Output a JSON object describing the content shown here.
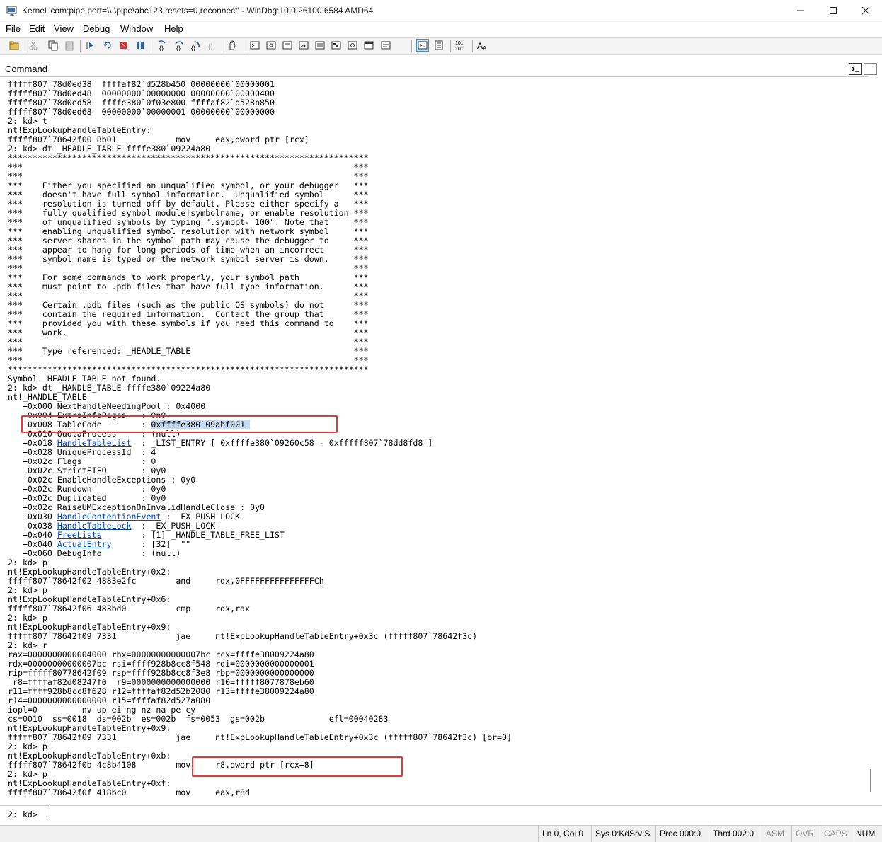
{
  "window": {
    "title": "Kernel 'com:pipe,port=\\\\.\\pipe\\abc123,resets=0,reconnect' - WinDbg:10.0.26100.6584 AMD64"
  },
  "menu": [
    {
      "accel": "F",
      "rest": "ile"
    },
    {
      "accel": "E",
      "rest": "dit"
    },
    {
      "accel": "V",
      "rest": "iew"
    },
    {
      "accel": "D",
      "rest": "ebug"
    },
    {
      "accel": "W",
      "rest": "indow"
    },
    {
      "accel": "H",
      "rest": "elp"
    }
  ],
  "toolbar_icons": [
    "open-icon",
    "cut-icon",
    "copy-icon",
    "paste-icon",
    "go-icon",
    "restart-icon",
    "stop-debugging-icon",
    "break-icon",
    "step-into-icon",
    "step-over-icon",
    "step-out-icon",
    "run-to-cursor-icon",
    "source-mode-icon",
    "command-icon",
    "watch-icon",
    "locals-icon",
    "registers-icon",
    "memory-icon",
    "call-stack-icon",
    "disassembly-icon",
    "scratch-pad-icon",
    "processes-icon",
    "source-mode-on-icon",
    "binary-icon",
    "font-icon",
    "options-icon"
  ],
  "panel": {
    "title": "Command"
  },
  "output_lines": [
    "fffff807`78d0ed38  ffffaf82`d528b450 00000000`00000001",
    "fffff807`78d0ed48  00000000`00000000 00000000`00000400",
    "fffff807`78d0ed58  ffffe380`0f03e800 ffffaf82`d528b850",
    "fffff807`78d0ed68  00000000`00000001 00000000`00000000",
    "2: kd> t",
    "nt!ExpLookupHandleTableEntry:",
    "fffff807`78642f00 8b01            mov     eax,dword ptr [rcx]",
    "2: kd> dt _HEADLE_TABLE ffffe380`09224a80",
    "*************************************************************************",
    "***                                                                   ***",
    "***                                                                   ***",
    "***    Either you specified an unqualified symbol, or your debugger   ***",
    "***    doesn't have full symbol information.  Unqualified symbol      ***",
    "***    resolution is turned off by default. Please either specify a   ***",
    "***    fully qualified symbol module!symbolname, or enable resolution ***",
    "***    of unqualified symbols by typing \".symopt- 100\". Note that     ***",
    "***    enabling unqualified symbol resolution with network symbol     ***",
    "***    server shares in the symbol path may cause the debugger to     ***",
    "***    appear to hang for long periods of time when an incorrect      ***",
    "***    symbol name is typed or the network symbol server is down.     ***",
    "***                                                                   ***",
    "***    For some commands to work properly, your symbol path           ***",
    "***    must point to .pdb files that have full type information.      ***",
    "***                                                                   ***",
    "***    Certain .pdb files (such as the public OS symbols) do not      ***",
    "***    contain the required information.  Contact the group that      ***",
    "***    provided you with these symbols if you need this command to    ***",
    "***    work.                                                          ***",
    "***                                                                   ***",
    "***    Type referenced: _HEADLE_TABLE                                 ***",
    "***                                                                   ***",
    "*************************************************************************",
    "Symbol _HEADLE_TABLE not found.",
    "2: kd> dt _HANDLE_TABLE ffffe380`09224a80",
    "nt!_HANDLE_TABLE",
    "   +0x000 NextHandleNeedingPool : 0x4000",
    "   +0x004 ExtraInfoPages   : 0n0",
    {
      "pre": "   +0x008 TableCode        : ",
      "hl": "0xffffe380`09abf001 "
    },
    "   +0x010 QuotaProcess     : (null)",
    {
      "pre": "   +0x018 ",
      "link": "HandleTableList",
      "post": "  : _LIST_ENTRY [ 0xffffe380`09260c58 - 0xfffff807`78dd8fd8 ]"
    },
    "   +0x028 UniqueProcessId  : 4",
    "   +0x02c Flags            : 0",
    "   +0x02c StrictFIFO       : 0y0",
    "   +0x02c EnableHandleExceptions : 0y0",
    "   +0x02c Rundown          : 0y0",
    "   +0x02c Duplicated       : 0y0",
    "   +0x02c RaiseUMExceptionOnInvalidHandleClose : 0y0",
    {
      "pre": "   +0x030 ",
      "link": "HandleContentionEvent",
      "post": " : _EX_PUSH_LOCK"
    },
    {
      "pre": "   +0x038 ",
      "link": "HandleTableLock",
      "post": "  : _EX_PUSH_LOCK"
    },
    {
      "pre": "   +0x040 ",
      "link": "FreeLists",
      "post": "        : [1] _HANDLE_TABLE_FREE_LIST"
    },
    {
      "pre": "   +0x040 ",
      "link": "ActualEntry",
      "post": "      : [32]  \"\""
    },
    "   +0x060 DebugInfo        : (null)",
    "2: kd> p",
    "nt!ExpLookupHandleTableEntry+0x2:",
    "fffff807`78642f02 4883e2fc        and     rdx,0FFFFFFFFFFFFFFFCh",
    "2: kd> p",
    "nt!ExpLookupHandleTableEntry+0x6:",
    "fffff807`78642f06 483bd0          cmp     rdx,rax",
    "2: kd> p",
    "nt!ExpLookupHandleTableEntry+0x9:",
    "fffff807`78642f09 7331            jae     nt!ExpLookupHandleTableEntry+0x3c (fffff807`78642f3c)",
    "2: kd> r",
    "rax=0000000000004000 rbx=00000000000007bc rcx=ffffe38009224a80",
    "rdx=00000000000007bc rsi=ffff928b8cc8f548 rdi=0000000000000001",
    "rip=fffff80778642f09 rsp=ffff928b8cc8f3e8 rbp=0000000000000000",
    " r8=ffffaf82d08247f0  r9=0000000000000000 r10=fffff8077878eb60",
    "r11=ffff928b8cc8f628 r12=ffffaf82d52b2080 r13=ffffe38009224a80",
    "r14=0000000000000000 r15=ffffaf82d527a080",
    "iopl=0         nv up ei ng nz na pe cy",
    "cs=0010  ss=0018  ds=002b  es=002b  fs=0053  gs=002b             efl=00040283",
    "nt!ExpLookupHandleTableEntry+0x9:",
    "fffff807`78642f09 7331            jae     nt!ExpLookupHandleTableEntry+0x3c (fffff807`78642f3c) [br=0]",
    "2: kd> p",
    "nt!ExpLookupHandleTableEntry+0xb:",
    "fffff807`78642f0b 4c8b4108        mov     r8,qword ptr [rcx+8]",
    "2: kd> p",
    "nt!ExpLookupHandleTableEntry+0xf:",
    "fffff807`78642f0f 418bc0          mov     eax,r8d"
  ],
  "input": {
    "prompt": "2: kd>",
    "value": ""
  },
  "status": {
    "position": "Ln 0, Col 0",
    "sys": "Sys 0:KdSrv:S",
    "proc": "Proc 000:0",
    "thrd": "Thrd 002:0",
    "asm": "ASM",
    "ovr": "OVR",
    "caps": "CAPS",
    "num": "NUM"
  }
}
